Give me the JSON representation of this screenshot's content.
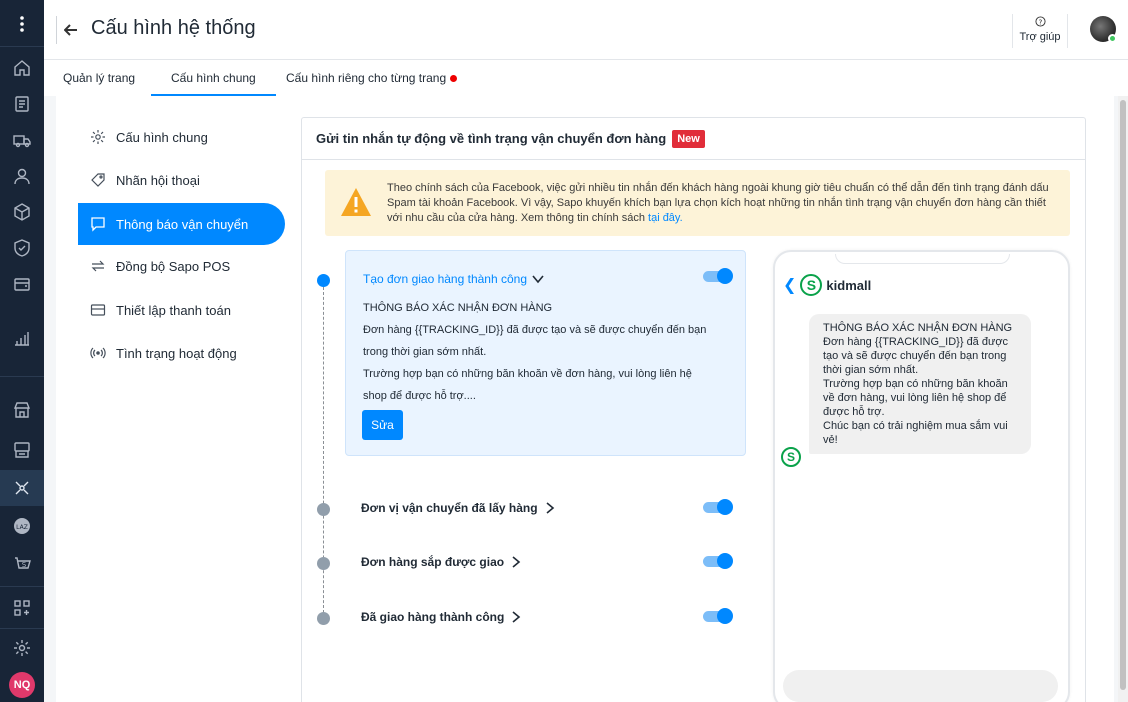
{
  "header": {
    "title": "Cấu hình hệ thống",
    "help_label": "Trợ giúp"
  },
  "tabs": [
    {
      "label": "Quản lý trang"
    },
    {
      "label": "Cấu hình chung"
    },
    {
      "label": "Cấu hình riêng cho từng trang"
    }
  ],
  "menu": [
    {
      "label": "Cấu hình chung",
      "icon": "gear-icon"
    },
    {
      "label": "Nhãn hội thoại",
      "icon": "tag-icon"
    },
    {
      "label": "Thông báo vận chuyển",
      "icon": "message-icon"
    },
    {
      "label": "Đồng bộ Sapo POS",
      "icon": "sync-icon"
    },
    {
      "label": "Thiết lập thanh toán",
      "icon": "card-icon"
    },
    {
      "label": "Tình trạng hoạt động",
      "icon": "signal-icon"
    }
  ],
  "rail": {
    "user_initials": "NQ"
  },
  "panel": {
    "title": "Gửi tin nhắn tự động về tình trạng vận chuyển đơn hàng",
    "badge": "New",
    "warning_text": "Theo chính sách của Facebook, việc gửi nhiều tin nhắn đến khách hàng ngoài khung giờ tiêu chuẩn có thể dẫn đến tình trạng đánh dấu Spam tài khoản Facebook. Vì vậy, Sapo khuyến khích bạn lựa chọn kích hoạt những tin nhắn tình trạng vận chuyển đơn hàng cần thiết với nhu cầu của cửa hàng. Xem thông tin chính sách ",
    "warning_link": "tại đây."
  },
  "steps": {
    "active": {
      "title": "Tạo đơn giao hàng thành công",
      "line1": "THÔNG BÁO XÁC NHẬN ĐƠN HÀNG",
      "line2": "Đơn hàng {{TRACKING_ID}} đã được tạo và sẽ được chuyển đến bạn",
      "line3": "trong thời gian sớm nhất.",
      "line4": "Trường hợp bạn có những băn khoăn về đơn hàng, vui lòng liên hệ",
      "line5": "shop để được hỗ trợ....",
      "edit_label": "Sửa",
      "enabled": true
    },
    "others": [
      {
        "title": "Đơn vị vận chuyển đã lấy hàng",
        "enabled": true
      },
      {
        "title": "Đơn hàng sắp được giao",
        "enabled": true
      },
      {
        "title": "Đã giao hàng thành công",
        "enabled": true
      }
    ]
  },
  "preview": {
    "page_name": "kidmall",
    "logo_letter": "S",
    "message": "THÔNG BÁO XÁC NHẬN ĐƠN HÀNG\nĐơn hàng {{TRACKING_ID}} đã được tạo và sẽ được chuyển đến bạn trong thời gian sớm nhất.\nTrường hợp bạn có những băn khoăn về đơn hàng, vui lòng liên hệ shop để được hỗ trợ.\nChúc bạn có trải nghiệm mua sắm vui vẻ!"
  },
  "colors": {
    "accent": "#0088ff",
    "rail_bg": "#182537",
    "warning_bg": "#fdf3d8",
    "badge_red": "#e12d39",
    "brand_green": "#0aa24a"
  }
}
